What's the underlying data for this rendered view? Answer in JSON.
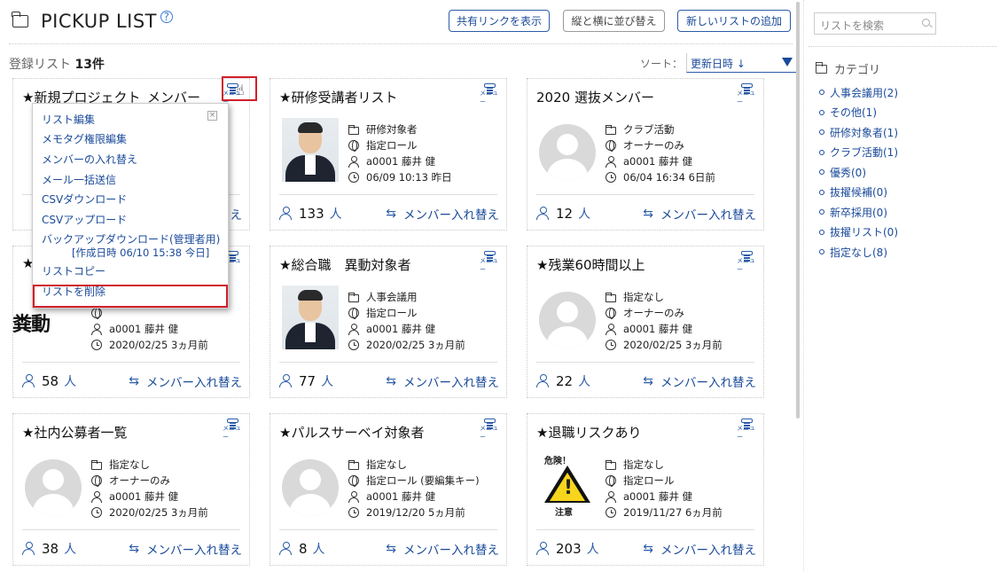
{
  "header": {
    "title": "PICKUP LIST",
    "help": "?",
    "btn_share": "共有リンクを表示",
    "btn_arrange": "縦と横に並び替え",
    "btn_new": "新しいリストの追加"
  },
  "summary": {
    "label": "登録リスト",
    "count": "13件"
  },
  "sort": {
    "label": "ソート：",
    "value": "更新日時 ↓"
  },
  "sidebar": {
    "search_placeholder": "リストを検索",
    "category_title": "カテゴリ",
    "categories": [
      "人事会議用(2)",
      "その他(1)",
      "研修対象者(1)",
      "クラブ活動(1)",
      "優秀(0)",
      "抜擢候補(0)",
      "新卒採用(0)",
      "抜擢リスト(0)",
      "指定なし(8)"
    ]
  },
  "menu_label": "メニュー",
  "swap_label": "メンバー入れ替え",
  "unit": "人",
  "cards": [
    {
      "title": "★新規プロジェクト_メンバー",
      "category": "",
      "role": "",
      "owner": "",
      "updated": "",
      "count": "",
      "img": "none"
    },
    {
      "title": "★研修受講者リスト",
      "category": "研修対象者",
      "role": "指定ロール",
      "owner": "a0001 藤井 健",
      "updated": "06/09 10:13 昨日",
      "count": "133",
      "img": "photo"
    },
    {
      "title": "2020 選抜メンバー",
      "category": "クラブ活動",
      "role": "オーナーのみ",
      "owner": "a0001 藤井 健",
      "updated": "06/04 16:34 6日前",
      "count": "12",
      "img": "avatar"
    },
    {
      "title": "★",
      "category": "",
      "role": "",
      "owner": "a0001 藤井 健",
      "updated": "2020/02/25 3ヵ月前",
      "count": "58",
      "img": "none"
    },
    {
      "title": "★総合職　異動対象者",
      "category": "人事会議用",
      "role": "指定ロール",
      "owner": "a0001 藤井 健",
      "updated": "2020/02/25 3ヵ月前",
      "count": "77",
      "img": "photo"
    },
    {
      "title": "★残業60時間以上",
      "category": "指定なし",
      "role": "オーナーのみ",
      "owner": "a0001 藤井 健",
      "updated": "2020/02/25 3ヵ月前",
      "count": "22",
      "img": "avatar"
    },
    {
      "title": "★社内公募者一覧",
      "category": "指定なし",
      "role": "オーナーのみ",
      "owner": "a0001 藤井 健",
      "updated": "2020/02/25 3ヵ月前",
      "count": "38",
      "img": "avatar"
    },
    {
      "title": "★パルスサーベイ対象者",
      "category": "指定なし",
      "role": "指定ロール (要編集キー)",
      "owner": "a0001 藤井 健",
      "updated": "2019/12/20 5ヵ月前",
      "count": "8",
      "img": "avatar"
    },
    {
      "title": "★退職リスクあり",
      "category": "指定なし",
      "role": "指定ロール",
      "owner": "a0001 藤井 健",
      "updated": "2019/11/27 6ヵ月前",
      "count": "203",
      "img": "warn"
    }
  ],
  "card0_partial": {
    "swap_tail": "え"
  },
  "card3_partial": {
    "img_text": "粪動"
  },
  "warn_img": {
    "top": "危険！",
    "bottom": "注意"
  },
  "dropdown": {
    "close": "×",
    "items": [
      "リスト編集",
      "メモタグ権限編集",
      "メンバーの入れ替え",
      "メール一括送信",
      "CSVダウンロード",
      "CSVアップロード",
      "バックアップダウンロード(管理者用)"
    ],
    "backup_note": "[作成日時 06/10 15:38 今日]",
    "copy": "リストコピー",
    "delete": "リストを削除"
  }
}
